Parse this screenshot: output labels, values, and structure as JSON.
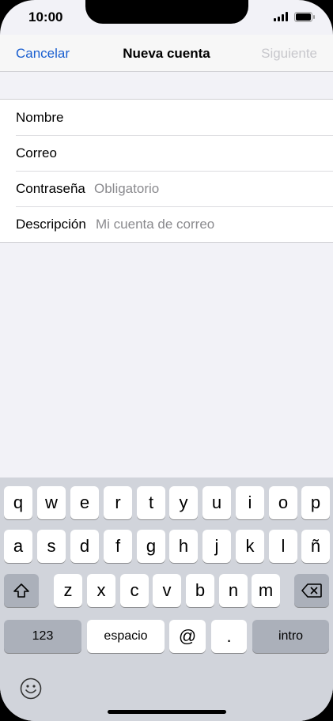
{
  "status": {
    "time": "10:00"
  },
  "nav": {
    "cancel": "Cancelar",
    "title": "Nueva cuenta",
    "next": "Siguiente"
  },
  "form": {
    "name_label": "Nombre",
    "email_label": "Correo",
    "password_label": "Contraseña",
    "password_placeholder": "Obligatorio",
    "description_label": "Descripción",
    "description_placeholder": "Mi cuenta de correo"
  },
  "keyboard": {
    "row1": [
      "q",
      "w",
      "e",
      "r",
      "t",
      "y",
      "u",
      "i",
      "o",
      "p"
    ],
    "row2": [
      "a",
      "s",
      "d",
      "f",
      "g",
      "h",
      "j",
      "k",
      "l",
      "ñ"
    ],
    "row3": [
      "z",
      "x",
      "c",
      "v",
      "b",
      "n",
      "m"
    ],
    "numbers": "123",
    "space": "espacio",
    "at": "@",
    "dot": ".",
    "return": "intro"
  }
}
